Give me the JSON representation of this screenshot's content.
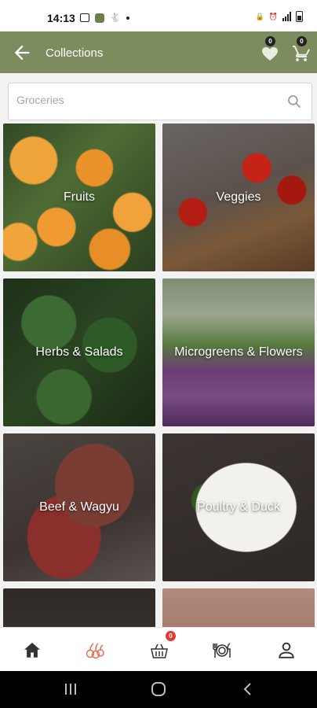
{
  "status_bar": {
    "time": "14:13"
  },
  "app_bar": {
    "title": "Collections",
    "wishlist_count": "0",
    "cart_count": "0"
  },
  "search": {
    "placeholder": "Groceries"
  },
  "collections": [
    {
      "label": "Fruits"
    },
    {
      "label": "Veggies"
    },
    {
      "label": "Herbs & Salads"
    },
    {
      "label": "Microgreens & Flowers"
    },
    {
      "label": "Beef & Wagyu"
    },
    {
      "label": "Poultry & Duck"
    }
  ],
  "bottom_nav": {
    "items": [
      "home-icon",
      "produce-icon",
      "basket-icon",
      "dining-icon",
      "profile-icon"
    ],
    "basket_badge": "0",
    "active": "produce-icon"
  },
  "colors": {
    "app_bar": "#7c8c5f",
    "active_nav": "#e26a4f",
    "badge": "#e53935"
  }
}
